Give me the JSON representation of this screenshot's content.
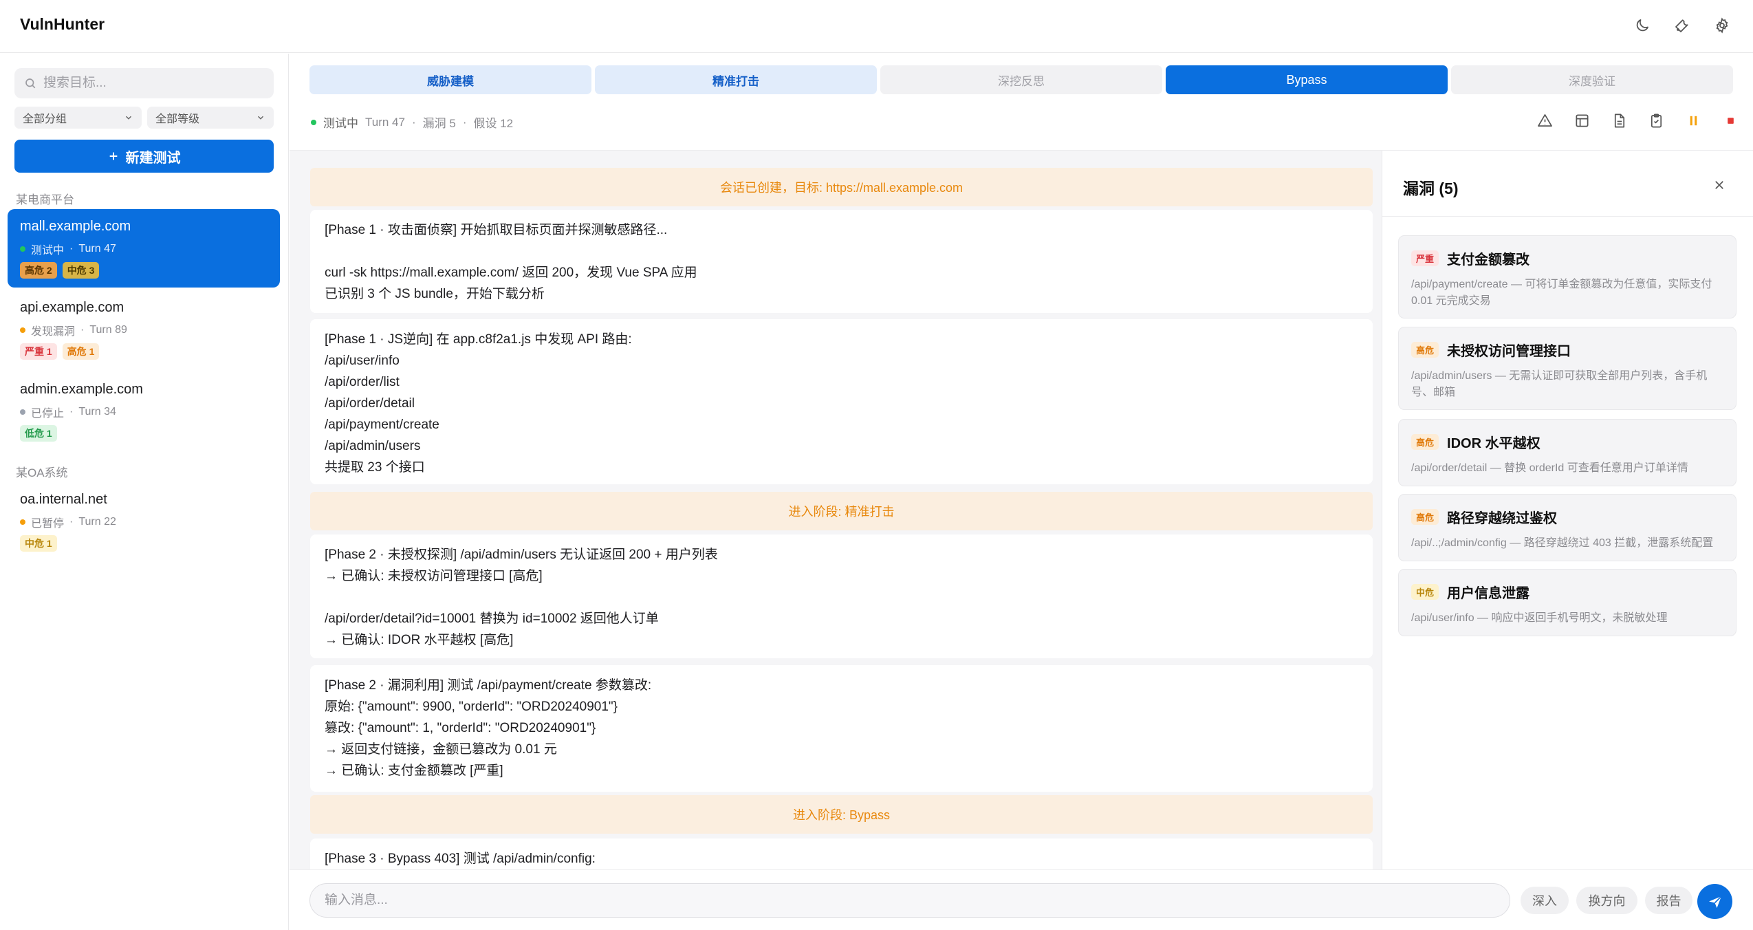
{
  "app": {
    "title": "VulnHunter"
  },
  "top_icons": [
    "moon-icon",
    "wrench-icon",
    "gear-icon"
  ],
  "sidebar": {
    "search_placeholder": "搜索目标...",
    "group_filter": "全部分组",
    "level_filter": "全部等级",
    "new_test_label": "新建测试",
    "groups": [
      {
        "label": "某电商平台",
        "targets": [
          {
            "name": "mall.example.com",
            "status": "测试中",
            "turn": "Turn 47",
            "status_color": "#22c55e",
            "badges": [
              {
                "label": "高危 2",
                "level": "high"
              },
              {
                "label": "中危 3",
                "level": "mid"
              }
            ]
          },
          {
            "name": "api.example.com",
            "status": "发现漏洞",
            "turn": "Turn 89",
            "status_color": "#f59e0b",
            "badges": [
              {
                "label": "严重 1",
                "level": "crit"
              },
              {
                "label": "高危 1",
                "level": "high"
              }
            ]
          },
          {
            "name": "admin.example.com",
            "status": "已停止",
            "turn": "Turn 34",
            "status_color": "#9ca3af",
            "badges": [
              {
                "label": "低危 1",
                "level": "low"
              }
            ]
          }
        ]
      },
      {
        "label": "某OA系统",
        "targets": [
          {
            "name": "oa.internal.net",
            "status": "已暂停",
            "turn": "Turn 22",
            "status_color": "#f59e0b",
            "badges": [
              {
                "label": "中危 1",
                "level": "mid"
              }
            ]
          }
        ]
      }
    ]
  },
  "phases": [
    {
      "label": "威胁建模",
      "state": "done"
    },
    {
      "label": "精准打击",
      "state": "done"
    },
    {
      "label": "深挖反思",
      "state": "todo"
    },
    {
      "label": "Bypass",
      "state": "current"
    },
    {
      "label": "深度验证",
      "state": "todo"
    }
  ],
  "status_bar": {
    "state": "测试中",
    "turn": "Turn 47",
    "vulns": "漏洞 5",
    "hypotheses": "假设 12",
    "sep": "·"
  },
  "action_icons": [
    "alert-triangle-icon",
    "layout-icon",
    "document-icon",
    "clipboard-icon",
    "pause-icon",
    "stop-icon"
  ],
  "feed": {
    "system_1": "会话已创建，目标: https://mall.example.com",
    "msg_1": "[Phase 1 · 攻击面侦察] 开始抓取目标页面并探测敏感路径...\n\ncurl -sk https://mall.example.com/ 返回 200，发现 Vue SPA 应用\n已识别 3 个 JS bundle，开始下载分析",
    "msg_2": "[Phase 1 · JS逆向] 在 app.c8f2a1.js 中发现 API 路由:\n/api/user/info\n/api/order/list\n/api/order/detail\n/api/payment/create\n/api/admin/users\n共提取 23 个接口",
    "system_2": "进入阶段: 精准打击",
    "msg_3": "[Phase 2 · 未授权探测] /api/admin/users 无认证返回 200 + 用户列表\n→ 已确认: 未授权访问管理接口 [高危]\n\n/api/order/detail?id=10001 替换为 id=10002 返回他人订单\n→ 已确认: IDOR 水平越权 [高危]",
    "msg_4": "[Phase 2 · 漏洞利用] 测试 /api/payment/create 参数篡改:\n原始: {\"amount\": 9900, \"orderId\": \"ORD20240901\"}\n篡改: {\"amount\": 1, \"orderId\": \"ORD20240901\"}\n→ 返回支付链接，金额已篡改为 0.01 元\n→ 已确认: 支付金额篡改 [严重]",
    "system_3": "进入阶段: Bypass",
    "msg_5": "[Phase 3 · Bypass 403] 测试 /api/admin/config:"
  },
  "composer": {
    "placeholder": "输入消息...",
    "chips": [
      "深入",
      "换方向",
      "报告"
    ]
  },
  "vuln_panel": {
    "title": "漏洞 (5)",
    "items": [
      {
        "level_label": "严重",
        "level": "crit",
        "name": "支付金额篡改",
        "desc": "/api/payment/create — 可将订单金额篡改为任意值，实际支付 0.01 元完成交易"
      },
      {
        "level_label": "高危",
        "level": "high",
        "name": "未授权访问管理接口",
        "desc": "/api/admin/users — 无需认证即可获取全部用户列表，含手机号、邮箱"
      },
      {
        "level_label": "高危",
        "level": "high",
        "name": "IDOR 水平越权",
        "desc": "/api/order/detail — 替换 orderId 可查看任意用户订单详情"
      },
      {
        "level_label": "高危",
        "level": "high",
        "name": "路径穿越绕过鉴权",
        "desc": "/api/..;/admin/config — 路径穿越绕过 403 拦截，泄露系统配置"
      },
      {
        "level_label": "中危",
        "level": "mid",
        "name": "用户信息泄露",
        "desc": "/api/user/info — 响应中返回手机号明文，未脱敏处理"
      }
    ]
  },
  "colors": {
    "accent": "#0a6fdf",
    "system_bg": "#fbeedf",
    "system_text": "#e8890f"
  }
}
